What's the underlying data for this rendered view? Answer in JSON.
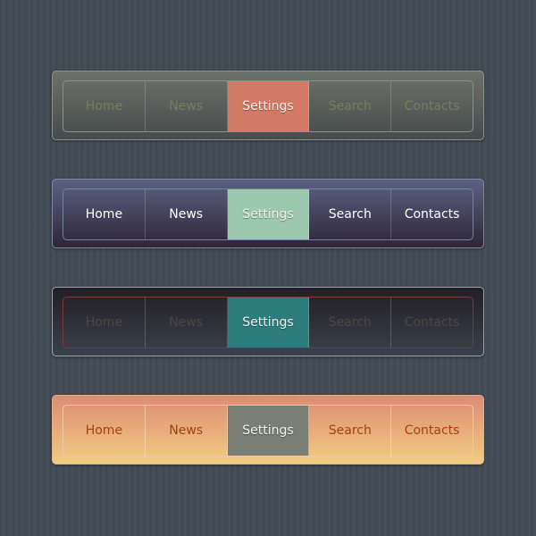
{
  "menus": [
    {
      "items": [
        "Home",
        "News",
        "Settings",
        "Search",
        "Contacts"
      ],
      "active": 2,
      "active_color": "#d27a66"
    },
    {
      "items": [
        "Home",
        "News",
        "Settings",
        "Search",
        "Contacts"
      ],
      "active": 2,
      "active_color": "#9cc9ad"
    },
    {
      "items": [
        "Home",
        "News",
        "Settings",
        "Search",
        "Contacts"
      ],
      "active": 2,
      "active_color": "#2e7d7d"
    },
    {
      "items": [
        "Home",
        "News",
        "Settings",
        "Search",
        "Contacts"
      ],
      "active": 2,
      "active_color": "#7b7e74"
    }
  ]
}
